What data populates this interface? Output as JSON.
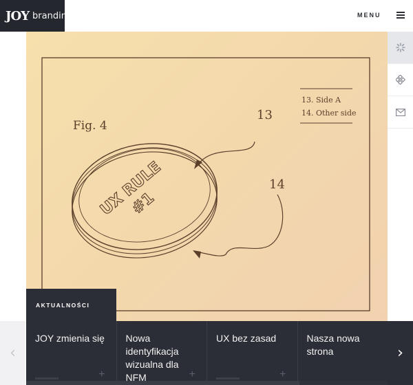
{
  "brand": {
    "mark": "JOY",
    "name": "branding."
  },
  "header": {
    "menu_label": "MENU"
  },
  "hero": {
    "fig_label": "Fig. 4",
    "coin_line1": "UX RULE",
    "coin_line2": "#1",
    "callout_13": "13",
    "callout_14": "14",
    "legend_line1": "13. Side A",
    "legend_line2": "14. Other side"
  },
  "side_icons": [
    "loader-icon",
    "grid-icon",
    "mail-icon"
  ],
  "news": {
    "tab_label": "AKTUALNOŚCI",
    "items": [
      {
        "title": "JOY zmienia się"
      },
      {
        "title": "Nowa identyfikacja wizualna dla NFM"
      },
      {
        "title": "UX bez zasad"
      },
      {
        "title": "Nasza nowa strona"
      }
    ]
  },
  "colors": {
    "dark": "#2b2e36",
    "hero_bg": "#f6deae",
    "ink": "#5a3f2b"
  }
}
